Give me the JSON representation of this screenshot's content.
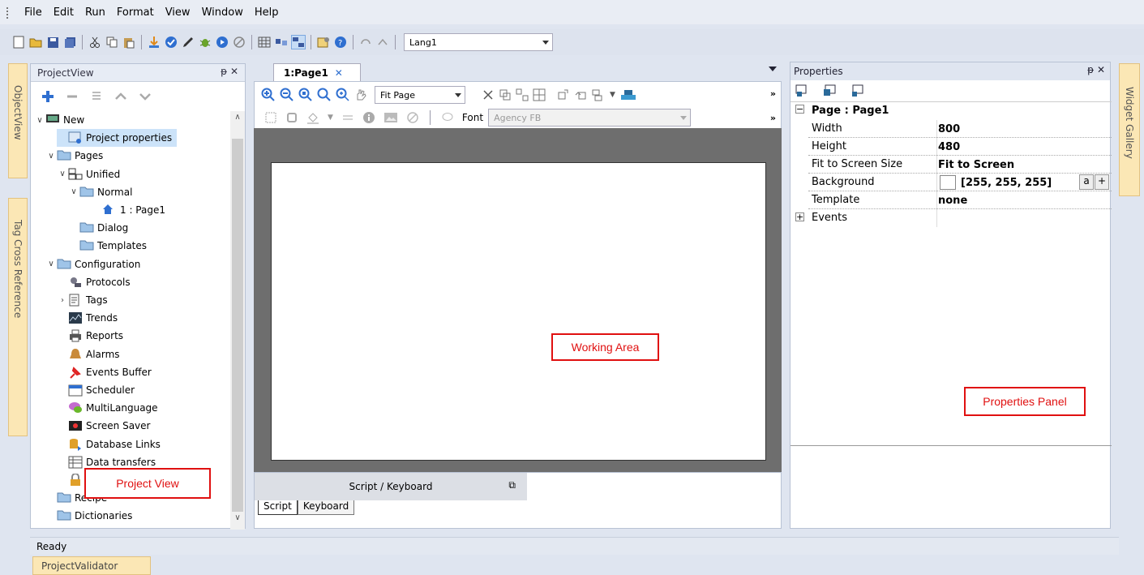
{
  "menu": [
    "File",
    "Edit",
    "Run",
    "Format",
    "View",
    "Window",
    "Help"
  ],
  "toolbar": {
    "lang_value": "Lang1"
  },
  "side_tabs": {
    "object_view": "ObjectView",
    "tag_cross_reference": "Tag Cross Reference",
    "widget_gallery": "Widget Gallery"
  },
  "project_view": {
    "title": "ProjectView",
    "title_controls": "ᵽ ✕",
    "tree": [
      {
        "label": "New",
        "level": 0,
        "expander": "∨",
        "icon": "monitor-icon"
      },
      {
        "label": "Project properties",
        "level": 2,
        "expander": "",
        "icon": "project-properties-icon",
        "selected": true
      },
      {
        "label": "Pages",
        "level": 1,
        "expander": "∨",
        "icon": "folder-icon"
      },
      {
        "label": "Unified",
        "level": 2,
        "expander": "∨",
        "icon": "unified-pages-icon"
      },
      {
        "label": "Normal",
        "level": 3,
        "expander": "∨",
        "icon": "folder-icon"
      },
      {
        "label": "1 : Page1",
        "level": 5,
        "expander": "",
        "icon": "page-home-icon"
      },
      {
        "label": "Dialog",
        "level": 3,
        "expander": "",
        "icon": "folder-icon"
      },
      {
        "label": "Templates",
        "level": 3,
        "expander": "",
        "icon": "folder-icon"
      },
      {
        "label": "Configuration",
        "level": 1,
        "expander": "∨",
        "icon": "folder-icon"
      },
      {
        "label": "Protocols",
        "level": 2,
        "expander": "",
        "icon": "protocols-icon"
      },
      {
        "label": "Tags",
        "level": 2,
        "expander": "›",
        "icon": "tags-icon"
      },
      {
        "label": "Trends",
        "level": 2,
        "expander": "",
        "icon": "trends-icon"
      },
      {
        "label": "Reports",
        "level": 2,
        "expander": "",
        "icon": "printer-icon"
      },
      {
        "label": "Alarms",
        "level": 2,
        "expander": "",
        "icon": "alarm-bell-icon"
      },
      {
        "label": "Events Buffer",
        "level": 2,
        "expander": "",
        "icon": "pin-icon"
      },
      {
        "label": "Scheduler",
        "level": 2,
        "expander": "",
        "icon": "calendar-icon"
      },
      {
        "label": "MultiLanguage",
        "level": 2,
        "expander": "",
        "icon": "speech-bubble-icon"
      },
      {
        "label": "Screen Saver",
        "level": 2,
        "expander": "",
        "icon": "screen-saver-icon"
      },
      {
        "label": "Database Links",
        "level": 2,
        "expander": "",
        "icon": "database-icon"
      },
      {
        "label": "Data transfers",
        "level": 2,
        "expander": "",
        "icon": "data-transfer-icon"
      },
      {
        "label": "Security",
        "level": 2,
        "expander": "",
        "icon": "security-icon"
      },
      {
        "label": "Recipe",
        "level": 1,
        "expander": "",
        "icon": "folder-icon"
      },
      {
        "label": "Dictionaries",
        "level": 1,
        "expander": "",
        "icon": "folder-icon"
      }
    ],
    "callout": "Project View"
  },
  "editor": {
    "tab_label": "1:Page1",
    "zoom_value": "Fit Page",
    "font_label": "Font",
    "font_value": "Agency FB",
    "callout": "Working Area",
    "script_panel_title": "Script / Keyboard",
    "script_tabs": [
      "Script",
      "Keyboard"
    ]
  },
  "properties": {
    "title": "Properties",
    "title_controls": "ᵽ ✕",
    "section": "Page : Page1",
    "rows": [
      {
        "key": "Width",
        "value": "800"
      },
      {
        "key": "Height",
        "value": "480"
      },
      {
        "key": "Fit to Screen Size",
        "value": "Fit to Screen"
      },
      {
        "key": "Background",
        "value": "[255, 255, 255]"
      },
      {
        "key": "Template",
        "value": "none"
      }
    ],
    "events_label": "Events",
    "bg_buttons": [
      "a",
      "+"
    ],
    "callout": "Properties Panel"
  },
  "status": {
    "text": "Ready"
  },
  "bottom_tab": "ProjectValidator"
}
